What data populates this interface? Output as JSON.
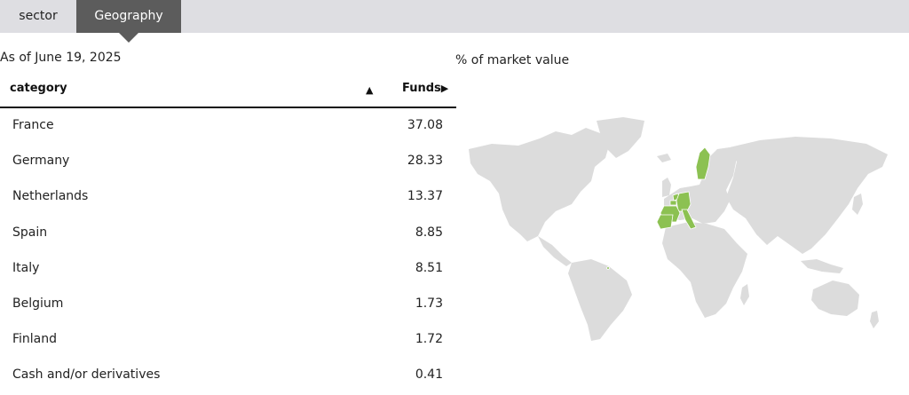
{
  "tabs": [
    {
      "label": "sector",
      "active": false
    },
    {
      "label": "Geography",
      "active": true
    }
  ],
  "as_of": "As of June 19, 2025",
  "map_caption": "% of market value",
  "table": {
    "headers": {
      "category": "category",
      "sort_glyph": "▲",
      "funds": "Funds",
      "funds_glyph": "▶"
    },
    "rows": [
      {
        "name": "France",
        "value": "37.08"
      },
      {
        "name": "Germany",
        "value": "28.33"
      },
      {
        "name": "Netherlands",
        "value": "13.37"
      },
      {
        "name": "Spain",
        "value": "8.85"
      },
      {
        "name": "Italy",
        "value": "8.51"
      },
      {
        "name": "Belgium",
        "value": "1.73"
      },
      {
        "name": "Finland",
        "value": "1.72"
      },
      {
        "name": "Cash and/or derivatives",
        "value": "0.41"
      }
    ]
  },
  "colors": {
    "highlight": "#8cc152",
    "land": "#dcdcdc",
    "tab_active": "#5c5c5c",
    "tab_bar": "#dedee2"
  }
}
